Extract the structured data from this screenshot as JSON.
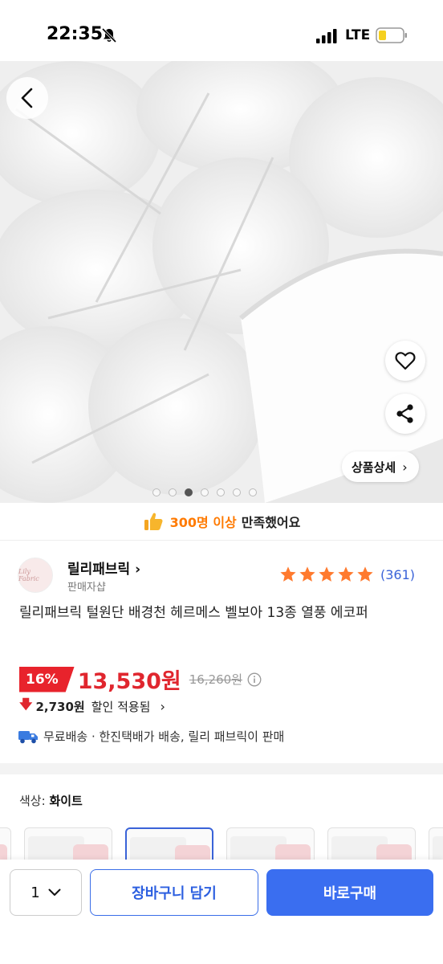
{
  "status": {
    "time": "22:35",
    "network": "LTE",
    "icons": [
      "bell-slash-icon",
      "signal-icon",
      "battery-icon"
    ]
  },
  "hero": {
    "back_icon": "chevron-left-icon",
    "like_icon": "heart-outline-icon",
    "share_icon": "share-icon",
    "detail_button": "상품상세",
    "detail_chevron": "›",
    "image_count": 7,
    "active_index": 3
  },
  "satisfaction": {
    "highlight": "300명 이상",
    "rest": "만족했어요",
    "icon": "thumbs-up-icon"
  },
  "seller": {
    "logo_text": "Lily Fabric",
    "name": "릴리패브릭 ›",
    "role": "판매자샵",
    "rating_stars": 5,
    "review_count": "(361)",
    "star_color": "#ff7a2e"
  },
  "product": {
    "title": "릴리패브릭 털원단 배경천 헤르메스 벨보아 13종 열풍 에코퍼"
  },
  "price": {
    "discount": "16%",
    "current": "13,530원",
    "original": "16,260원",
    "saving_amount": "2,730원",
    "saving_text": "할인 적용됨",
    "chevron": "›",
    "accent_color": "#e0262e"
  },
  "shipping": {
    "text": "무료배송 · 한진택배가 배송, 릴리 패브릭이 판매",
    "icon": "truck-icon"
  },
  "options": {
    "label": "색상:",
    "selected_value": "화이트"
  },
  "bottom_bar": {
    "quantity": "1",
    "cart_label": "장바구니 담기",
    "buy_label": "바로구매",
    "primary_color": "#3a6ef0"
  }
}
